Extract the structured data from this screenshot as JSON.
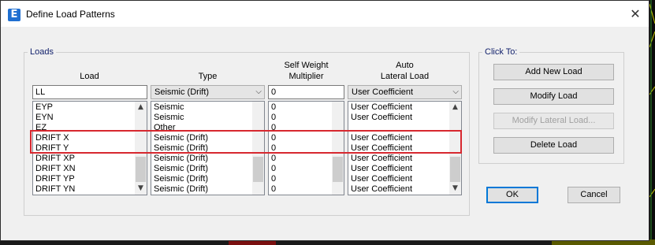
{
  "window": {
    "title": "Define Load Patterns"
  },
  "loads_group": {
    "legend": "Loads",
    "headers": {
      "load": "Load",
      "type": "Type",
      "self_weight_line1": "Self Weight",
      "self_weight_line2": "Multiplier",
      "auto_line1": "Auto",
      "auto_line2": "Lateral Load"
    },
    "edit_row": {
      "load": "LL",
      "type": "Seismic (Drift)",
      "self_weight": "0",
      "auto_lateral": "User Coefficient"
    },
    "rows": [
      {
        "load": "EYP",
        "type": "Seismic",
        "self_weight": "0",
        "auto": "User Coefficient"
      },
      {
        "load": "EYN",
        "type": "Seismic",
        "self_weight": "0",
        "auto": "User Coefficient"
      },
      {
        "load": "EZ",
        "type": "Other",
        "self_weight": "0",
        "auto": ""
      },
      {
        "load": "DRIFT X",
        "type": "Seismic (Drift)",
        "self_weight": "0",
        "auto": "User Coefficient"
      },
      {
        "load": "DRIFT Y",
        "type": "Seismic (Drift)",
        "self_weight": "0",
        "auto": "User Coefficient"
      },
      {
        "load": "DRIFT XP",
        "type": "Seismic (Drift)",
        "self_weight": "0",
        "auto": "User Coefficient"
      },
      {
        "load": "DRIFT XN",
        "type": "Seismic (Drift)",
        "self_weight": "0",
        "auto": "User Coefficient"
      },
      {
        "load": "DRIFT YP",
        "type": "Seismic (Drift)",
        "self_weight": "0",
        "auto": "User Coefficient"
      },
      {
        "load": "DRIFT YN",
        "type": "Seismic (Drift)",
        "self_weight": "0",
        "auto": "User Coefficient"
      }
    ]
  },
  "click_to": {
    "legend": "Click To:",
    "add_new_load": "Add New Load",
    "modify_load": "Modify Load",
    "modify_lateral_load": "Modify Lateral Load...",
    "delete_load": "Delete Load"
  },
  "footer": {
    "ok": "OK",
    "cancel": "Cancel"
  },
  "icons": {
    "app": "etabs-app-icon",
    "close": "close-icon"
  },
  "colors": {
    "highlight": "#d7282f",
    "legend": "#0f1e6a",
    "focus": "#0078d7"
  }
}
